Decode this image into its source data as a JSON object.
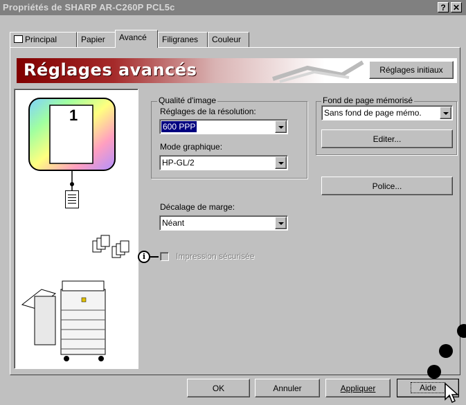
{
  "window": {
    "title": "Propriétés de SHARP AR-C260P PCL5c",
    "help_glyph": "?",
    "close_glyph": "✕"
  },
  "tabs": [
    {
      "label": "Principal",
      "active": false
    },
    {
      "label": "Papier",
      "active": false
    },
    {
      "label": "Avancé",
      "active": true
    },
    {
      "label": "Filigranes",
      "active": false
    },
    {
      "label": "Couleur",
      "active": false
    }
  ],
  "banner": {
    "title": "Réglages avancés",
    "reset_button": "Réglages initiaux"
  },
  "preview": {
    "page_number": "1"
  },
  "image_quality": {
    "group_label": "Qualité d'image",
    "resolution_label": "Réglages de la résolution:",
    "resolution_value": "600 PPP",
    "graphics_mode_label": "Mode graphique:",
    "graphics_mode_value": "HP-GL/2"
  },
  "margin": {
    "label": "Décalage de marge:",
    "value": "Néant"
  },
  "secure_print": {
    "label": "Impression sécurisée",
    "checked": false,
    "enabled": false
  },
  "stored_background": {
    "group_label": "Fond de page mémorisé",
    "value": "Sans fond de page mémo.",
    "edit_button": "Editer..."
  },
  "font_button": "Police...",
  "footer": {
    "ok": "OK",
    "cancel": "Annuler",
    "apply": "Appliquer",
    "help": "Aide"
  },
  "colors": {
    "title_bar": "#808080",
    "dialog": "#c0c0c0",
    "selection": "#000080",
    "banner_start": "#800000"
  },
  "icons": [
    "help-question-icon",
    "close-icon",
    "printer-tab-icon",
    "document-icon",
    "collate-pages-icon",
    "info-icon",
    "copier-machine-icon",
    "mouse-cursor-icon"
  ]
}
